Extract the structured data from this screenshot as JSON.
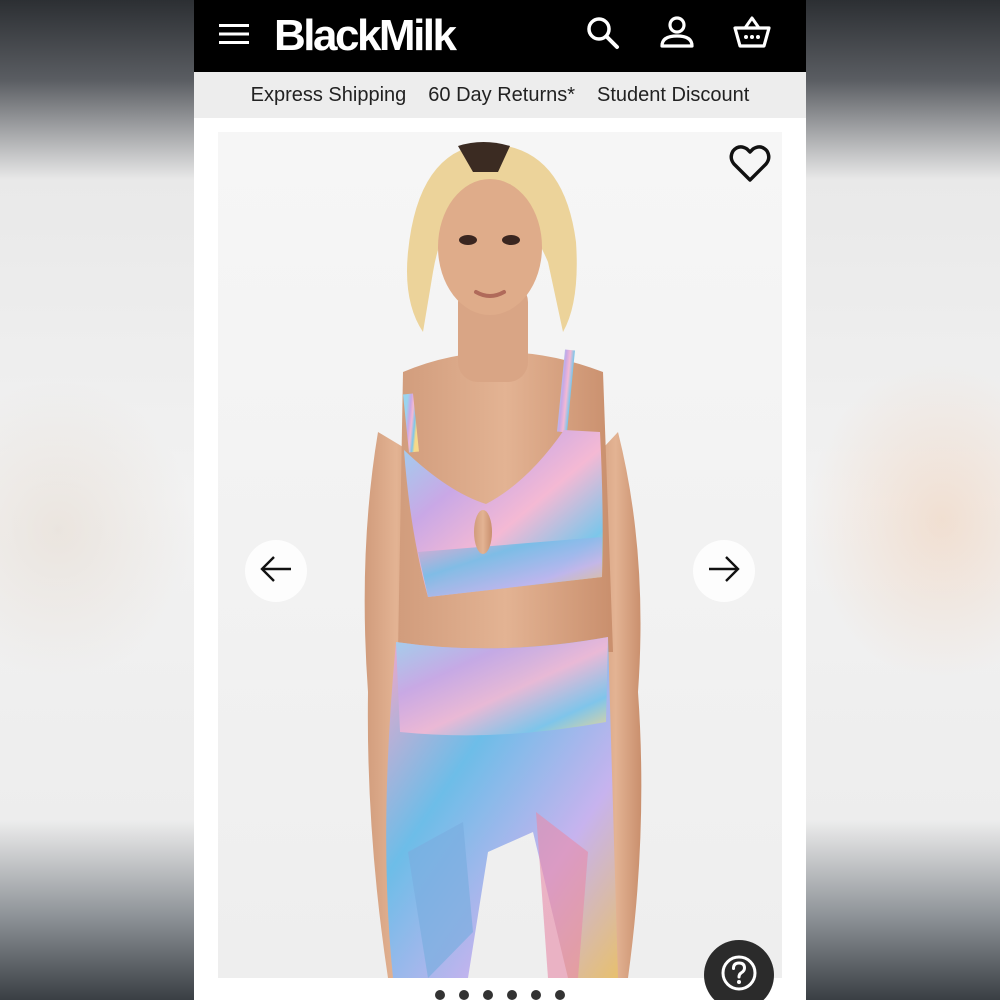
{
  "header": {
    "logo_text": "BlackMilk",
    "menu_icon": "hamburger-menu-icon",
    "search_icon": "search-icon",
    "account_icon": "user-icon",
    "basket_icon": "basket-icon"
  },
  "promo_bar": {
    "items": [
      "Express Shipping",
      "60 Day Returns*",
      "Student Discount"
    ]
  },
  "gallery": {
    "wishlist_icon": "heart-icon",
    "prev_icon": "arrow-left-icon",
    "next_icon": "arrow-right-icon",
    "image_count": 6,
    "active_index": 1
  },
  "help_button": {
    "icon": "question-mark-icon"
  },
  "colors": {
    "header_bg": "#000000",
    "promo_bg": "#ededed",
    "help_bg": "#2b2b2b"
  }
}
